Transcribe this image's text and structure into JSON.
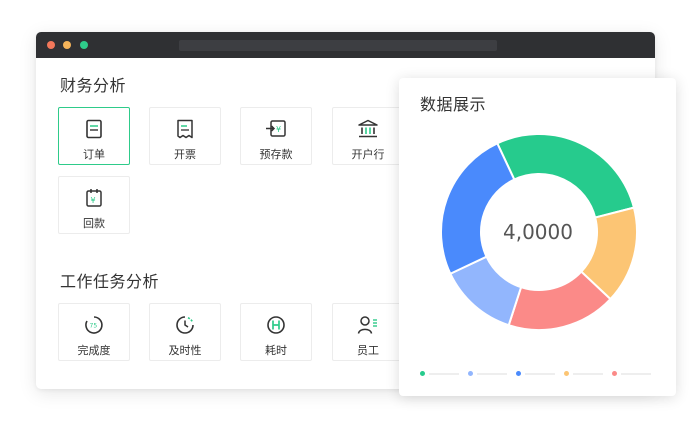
{
  "window": {
    "section1_title": "财务分析",
    "section2_title": "工作任务分析",
    "finance_tiles": [
      {
        "label": "订单",
        "icon": "order-doc-icon",
        "active": true
      },
      {
        "label": "开票",
        "icon": "invoice-receipt-icon",
        "active": false
      },
      {
        "label": "预存款",
        "icon": "prepaid-deposit-icon",
        "active": false
      },
      {
        "label": "开户行",
        "icon": "bank-icon",
        "active": false
      },
      {
        "label": "回款",
        "icon": "payment-return-icon",
        "active": false
      }
    ],
    "task_tiles": [
      {
        "label": "完成度",
        "icon": "completion-gauge-icon"
      },
      {
        "label": "及时性",
        "icon": "timeliness-clock-icon"
      },
      {
        "label": "耗时",
        "icon": "time-spent-icon"
      },
      {
        "label": "员工",
        "icon": "employee-icon"
      }
    ]
  },
  "card": {
    "title": "数据展示",
    "center_value": "4,0000"
  },
  "chart_data": {
    "type": "pie",
    "title": "",
    "segments": [
      {
        "value": 28,
        "color": "#26cb8d"
      },
      {
        "value": 16,
        "color": "#fcc574"
      },
      {
        "value": 18,
        "color": "#fb8a88"
      },
      {
        "value": 13,
        "color": "#92b6fd"
      },
      {
        "value": 25,
        "color": "#4a8afc"
      }
    ],
    "legend_colors": [
      "#26cb8d",
      "#92b6fd",
      "#4a8afc",
      "#fcc574",
      "#fb8a88"
    ]
  },
  "colors": {
    "accent": "#2ecb8a",
    "titlebar": "#2f3033"
  }
}
